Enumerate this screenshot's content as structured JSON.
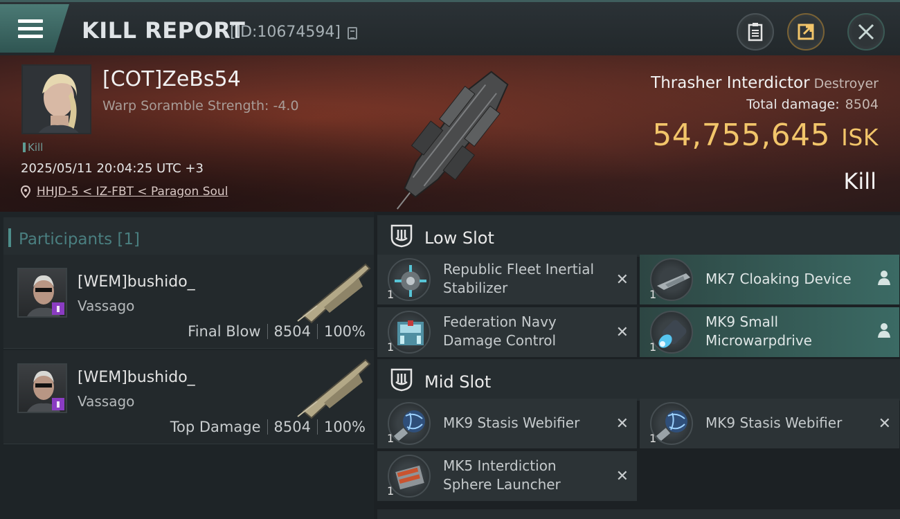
{
  "header": {
    "title": "KILL REPORT",
    "report_id": "[ID:10674594]",
    "buttons": [
      "clipboard-icon",
      "share-icon",
      "close-icon"
    ]
  },
  "victim": {
    "name": "[COT]ZeBs54",
    "scramble": "Warp Soramble Strength: -4.0",
    "tag": "Kill",
    "datetime": "2025/05/11 20:04:25 UTC +3",
    "location": "HHJD-5 < IZ-FBT < Paragon Soul",
    "ship_name": "Thrasher Interdictor",
    "ship_class": "Destroyer",
    "total_damage_label": "Total damage:",
    "total_damage": "8504",
    "isk_value": "54,755,645",
    "isk_unit": "ISK",
    "result": "Kill"
  },
  "participants": {
    "header": "Participants [1]",
    "rows": [
      {
        "name": "[WEM]bushido_",
        "ship": "Vassago",
        "role": "Final Blow",
        "damage": "8504",
        "percent": "100%"
      },
      {
        "name": "[WEM]bushido_",
        "ship": "Vassago",
        "role": "Top Damage",
        "damage": "8504",
        "percent": "100%"
      }
    ]
  },
  "fitting": {
    "low_slot": {
      "label": "Low Slot",
      "modules": [
        {
          "name_line1": "Republic Fleet Inertial",
          "name_line2": "Stabilizer",
          "qty": "1",
          "status": "destroyed"
        },
        {
          "name_line1": "MK7 Cloaking Device",
          "name_line2": "",
          "qty": "1",
          "status": "dropped"
        },
        {
          "name_line1": "Federation Navy",
          "name_line2": "Damage Control",
          "qty": "1",
          "status": "destroyed"
        },
        {
          "name_line1": "MK9 Small",
          "name_line2": "Microwarpdrive",
          "qty": "1",
          "status": "dropped"
        }
      ]
    },
    "mid_slot": {
      "label": "Mid Slot",
      "modules": [
        {
          "name_line1": "MK9 Stasis Webifier",
          "name_line2": "",
          "qty": "1",
          "status": "destroyed"
        },
        {
          "name_line1": "MK9 Stasis Webifier",
          "name_line2": "",
          "qty": "1",
          "status": "destroyed"
        },
        {
          "name_line1": "MK5 Interdiction",
          "name_line2": "Sphere Launcher",
          "qty": "1",
          "status": "destroyed"
        }
      ]
    }
  },
  "colors": {
    "accent": "#4d8e8b",
    "isk": "#f2c56a",
    "dropped_bg": "#3b6a64",
    "corp_badge": "#8a3cc2"
  }
}
